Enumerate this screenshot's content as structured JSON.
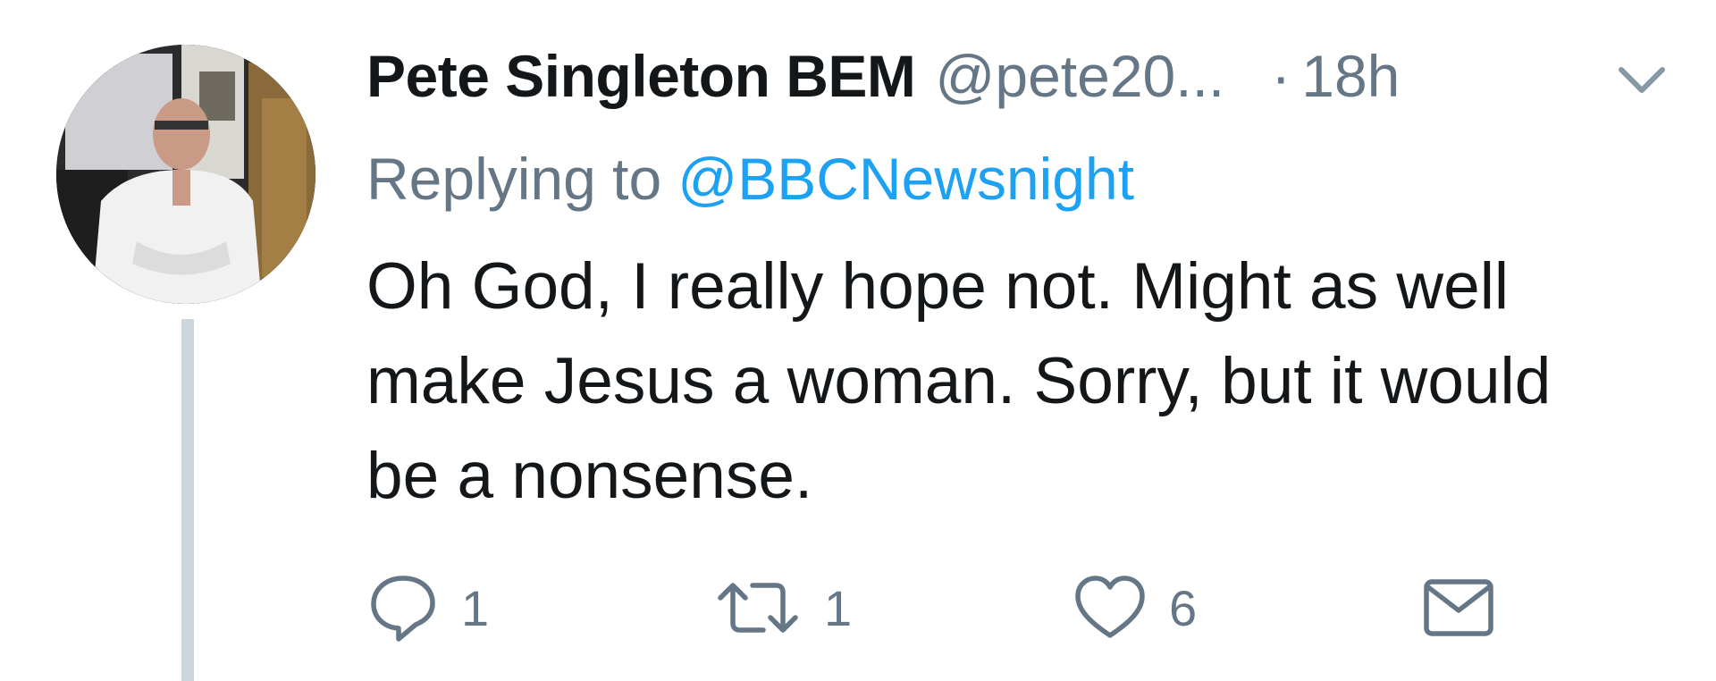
{
  "tweet": {
    "author": {
      "display_name": "Pete Singleton BEM",
      "handle": "@pete20...",
      "avatar_icon": "profile-photo"
    },
    "separator": "·",
    "timestamp": "18h",
    "caret_icon": "chevron-down-icon",
    "replying": {
      "prefix": "Replying to",
      "mention": "@BBCNewsnight"
    },
    "text_lines": [
      "Oh God, I really hope not. Might as well",
      "make Jesus a woman. Sorry, but it would",
      "be a nonsense."
    ],
    "actions": {
      "reply": {
        "icon": "speech-bubble-icon",
        "count": "1"
      },
      "retweet": {
        "icon": "retweet-icon",
        "count": "1"
      },
      "like": {
        "icon": "heart-icon",
        "count": "6"
      },
      "direct_message": {
        "icon": "envelope-icon"
      }
    }
  },
  "colors": {
    "text_primary": "#14171a",
    "text_secondary": "#657786",
    "link": "#1da1f2",
    "thread_line": "#ccd6dd",
    "background": "#ffffff"
  }
}
